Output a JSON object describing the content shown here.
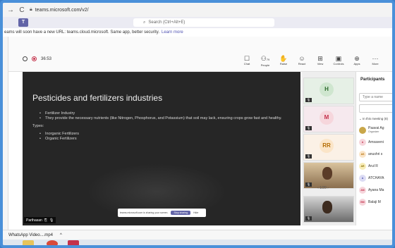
{
  "browser": {
    "back": "→",
    "reload": "C",
    "url": "teams.microsoft.com/v2/"
  },
  "teams": {
    "logo_text": "T",
    "search_placeholder": "Search (Ctrl+Alt+E)"
  },
  "notice": {
    "text": "eams will soon have a new URL: teams.cloud.microsoft. Same app, better security.",
    "link": "Learn more"
  },
  "meeting": {
    "timer": "36:53",
    "tools": [
      {
        "label": "Chat",
        "icon": "chat-icon",
        "glyph": "☐"
      },
      {
        "label": "People",
        "icon": "people-icon",
        "glyph": "⚇"
      },
      {
        "label": "Raise",
        "icon": "raise-hand-icon",
        "glyph": "✋"
      },
      {
        "label": "React",
        "icon": "react-icon",
        "glyph": "☺"
      },
      {
        "label": "View",
        "icon": "view-icon",
        "glyph": "⊞"
      },
      {
        "label": "Controls",
        "icon": "controls-icon",
        "glyph": "▣"
      },
      {
        "label": "Apps",
        "icon": "apps-icon",
        "glyph": "⊕"
      },
      {
        "label": "More",
        "icon": "more-icon",
        "glyph": "···"
      }
    ],
    "people_count": "79"
  },
  "slide": {
    "title": "Pesticides and fertilizers industries",
    "bullets": [
      "Fertilizer Industry",
      "They provide the necessary nutrients (like Nitrogen, Phosphorus, and Potassium) that soil may lack, ensuring crops grow fast and healthy."
    ],
    "types_label": "Types:",
    "types": [
      "Inorganic Fertilizers",
      "Organic Fertilizers"
    ],
    "presenter": "Parthasan"
  },
  "share_toast": {
    "text": "teams.microsoft.com is sharing your screen.",
    "stop": "Stop sharing",
    "hide": "Hide"
  },
  "tiles": {
    "t1": "H",
    "t2": "M",
    "t3": "RR",
    "pager": "1/20"
  },
  "panel": {
    "title": "Participants",
    "search_placeholder": "Type a name",
    "in_meeting": "In this meeting (8)",
    "people": [
      {
        "initials": "",
        "name": "Paavai Ag",
        "sub": "Organizer",
        "color": "#8b6b2f",
        "bg": "#c9a74a"
      },
      {
        "initials": "A",
        "name": "Amsaveni",
        "sub": "",
        "color": "#c4314b",
        "bg": "#f6d6dc"
      },
      {
        "initials": "AS",
        "name": "anushri s",
        "sub": "",
        "color": "#b36b00",
        "bg": "#fbe5c8"
      },
      {
        "initials": "AR",
        "name": "Arul R",
        "sub": "",
        "color": "#8a6d00",
        "bg": "#f8edb8"
      },
      {
        "initials": "A",
        "name": "ATCHAYA",
        "sub": "",
        "color": "#4f52b2",
        "bg": "#dcdcf4"
      },
      {
        "initials": "AM",
        "name": "Ayana Ma",
        "sub": "",
        "color": "#c4314b",
        "bg": "#f6d6dc"
      },
      {
        "initials": "BM",
        "name": "Balaji M",
        "sub": "",
        "color": "#c4314b",
        "bg": "#f6d6dc"
      }
    ]
  },
  "download": {
    "file": "WhatsApp Video....mp4",
    "chevron": "^"
  }
}
